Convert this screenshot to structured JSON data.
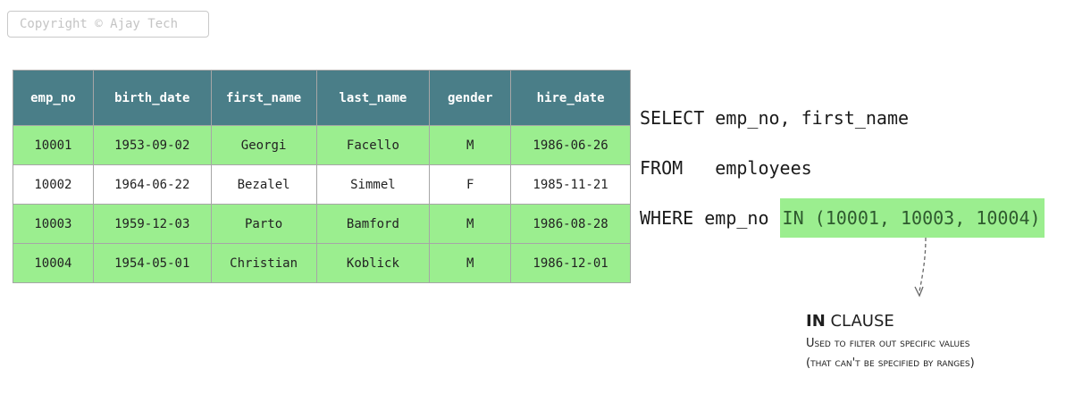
{
  "copyright": "Copyright © Ajay Tech",
  "table": {
    "columns": [
      "emp_no",
      "birth_date",
      "first_name",
      "last_name",
      "gender",
      "hire_date"
    ],
    "rows": [
      {
        "highlighted": true,
        "cells": [
          "10001",
          "1953-09-02",
          "Georgi",
          "Facello",
          "M",
          "1986-06-26"
        ]
      },
      {
        "highlighted": false,
        "cells": [
          "10002",
          "1964-06-22",
          "Bezalel",
          "Simmel",
          "F",
          "1985-11-21"
        ]
      },
      {
        "highlighted": true,
        "cells": [
          "10003",
          "1959-12-03",
          "Parto",
          "Bamford",
          "M",
          "1986-08-28"
        ]
      },
      {
        "highlighted": true,
        "cells": [
          "10004",
          "1954-05-01",
          "Christian",
          "Koblick",
          "M",
          "1986-12-01"
        ]
      }
    ],
    "header_color": "#4a7e88",
    "highlight_color": "#9bee8f"
  },
  "sql": {
    "line1": "SELECT emp_no, first_name",
    "line2": "FROM   employees",
    "line3_prefix": "WHERE emp_no ",
    "line3_highlight": "IN (10001, 10003, 10004)"
  },
  "annotation": {
    "title_keyword": "IN",
    "title_rest": " CLAUSE",
    "line1": "Used to filter out specific values",
    "line2": "(that can't be specified by ranges)",
    "arrow_icon": "dashed-down-arrow-icon"
  }
}
